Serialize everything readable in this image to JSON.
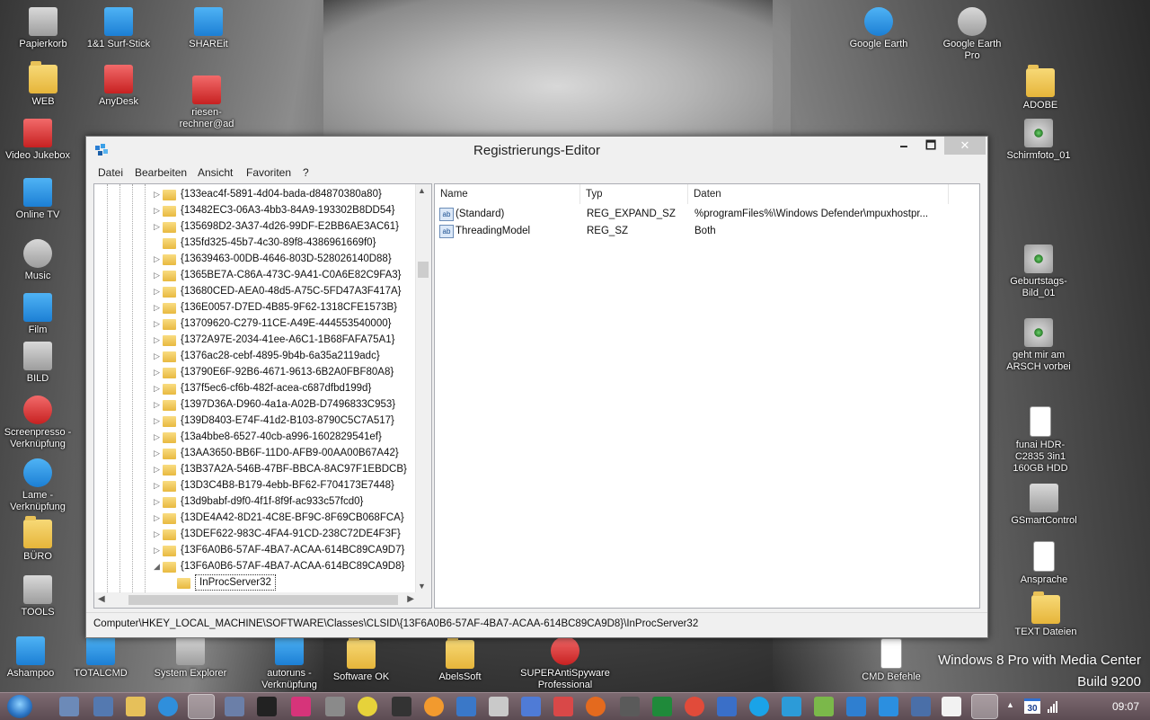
{
  "desktop": {
    "icons": [
      {
        "label": "Papierkorb",
        "icon": "recycle-bin"
      },
      {
        "label": "1&1 Surf-Stick",
        "icon": "surf-stick"
      },
      {
        "label": "SHAREit",
        "icon": "shareit"
      },
      {
        "label": "Google Earth",
        "icon": "google-earth"
      },
      {
        "label": "Google Earth Pro",
        "icon": "google-earth-pro"
      },
      {
        "label": "WEB",
        "icon": "folder"
      },
      {
        "label": "AnyDesk",
        "icon": "anydesk"
      },
      {
        "label": "riesen-rechner@ad",
        "icon": "shortcut"
      },
      {
        "label": "ADOBE",
        "icon": "folder"
      },
      {
        "label": "Video Jukebox",
        "icon": "jukebox"
      },
      {
        "label": "Schirmfoto_01",
        "icon": "eye-image"
      },
      {
        "label": "Online TV",
        "icon": "tv"
      },
      {
        "label": "Music",
        "icon": "music"
      },
      {
        "label": "Film",
        "icon": "film"
      },
      {
        "label": "Geburtstags-Bild_01",
        "icon": "eye-image"
      },
      {
        "label": "BILD",
        "icon": "camera"
      },
      {
        "label": "geht mir am ARSCH vorbei",
        "icon": "eye-image"
      },
      {
        "label": "Screenpresso - Verknüpfung",
        "icon": "screenpresso"
      },
      {
        "label": "funai HDR-C2835 3in1 160GB HDD",
        "icon": "document"
      },
      {
        "label": "Lame - Verknüpfung",
        "icon": "lame"
      },
      {
        "label": "BÜRO",
        "icon": "folder"
      },
      {
        "label": "GSmartControl",
        "icon": "gsmartcontrol"
      },
      {
        "label": "TOOLS",
        "icon": "tools"
      },
      {
        "label": "Ansprache",
        "icon": "document"
      },
      {
        "label": "TEXT Dateien",
        "icon": "folder"
      },
      {
        "label": "Ashampoo",
        "icon": "ashampoo"
      },
      {
        "label": "TOTALCMD",
        "icon": "totalcmd"
      },
      {
        "label": "System Explorer",
        "icon": "system-explorer"
      },
      {
        "label": "autoruns - Verknüpfung",
        "icon": "autoruns"
      },
      {
        "label": "Software OK",
        "icon": "folder"
      },
      {
        "label": "AbelsSoft",
        "icon": "folder"
      },
      {
        "label": "SUPERAntiSpyware Professional",
        "icon": "superantispyware"
      },
      {
        "label": "CMD Befehle",
        "icon": "pdf"
      }
    ],
    "watermark_line1": "Windows 8 Pro with Media Center",
    "watermark_line2": "Build 9200"
  },
  "window": {
    "title": "Registrierungs-Editor",
    "minimize": "🗕",
    "maximize": "🗖",
    "close": "✕",
    "menu": [
      "Datei",
      "Bearbeiten",
      "Ansicht",
      "Favoriten",
      "?"
    ],
    "tree": [
      {
        "label": "{133eac4f-5891-4d04-bada-d84870380a80}",
        "expander": "▷"
      },
      {
        "label": "{13482EC3-06A3-4bb3-84A9-193302B8DD54}",
        "expander": "▷"
      },
      {
        "label": "{135698D2-3A37-4d26-99DF-E2BB6AE3AC61}",
        "expander": "▷"
      },
      {
        "label": "{135fd325-45b7-4c30-89f8-4386961669f0}",
        "expander": ""
      },
      {
        "label": "{13639463-00DB-4646-803D-528026140D88}",
        "expander": "▷"
      },
      {
        "label": "{1365BE7A-C86A-473C-9A41-C0A6E82C9FA3}",
        "expander": "▷"
      },
      {
        "label": "{13680CED-AEA0-48d5-A75C-5FD47A3F417A}",
        "expander": "▷"
      },
      {
        "label": "{136E0057-D7ED-4B85-9F62-1318CFE1573B}",
        "expander": "▷"
      },
      {
        "label": "{13709620-C279-11CE-A49E-444553540000}",
        "expander": "▷"
      },
      {
        "label": "{1372A97E-2034-41ee-A6C1-1B68FAFA75A1}",
        "expander": "▷"
      },
      {
        "label": "{1376ac28-cebf-4895-9b4b-6a35a2119adc}",
        "expander": "▷"
      },
      {
        "label": "{13790E6F-92B6-4671-9613-6B2A0FBF80A8}",
        "expander": "▷"
      },
      {
        "label": "{137f5ec6-cf6b-482f-acea-c687dfbd199d}",
        "expander": "▷"
      },
      {
        "label": "{1397D36A-D960-4a1a-A02B-D7496833C953}",
        "expander": "▷"
      },
      {
        "label": "{139D8403-E74F-41d2-B103-8790C5C7A517}",
        "expander": "▷"
      },
      {
        "label": "{13a4bbe8-6527-40cb-a996-1602829541ef}",
        "expander": "▷"
      },
      {
        "label": "{13AA3650-BB6F-11D0-AFB9-00AA00B67A42}",
        "expander": "▷"
      },
      {
        "label": "{13B37A2A-546B-47BF-BBCA-8AC97F1EBDCB}",
        "expander": "▷"
      },
      {
        "label": "{13D3C4B8-B179-4ebb-BF62-F704173E7448}",
        "expander": "▷"
      },
      {
        "label": "{13d9babf-d9f0-4f1f-8f9f-ac933c57fcd0}",
        "expander": "▷"
      },
      {
        "label": "{13DE4A42-8D21-4C8E-BF9C-8F69CB068FCA}",
        "expander": "▷"
      },
      {
        "label": "{13DEF622-983C-4FA4-91CD-238C72DE4F3F}",
        "expander": "▷"
      },
      {
        "label": "{13F6A0B6-57AF-4BA7-ACAA-614BC89CA9D7}",
        "expander": "▷"
      },
      {
        "label": "{13F6A0B6-57AF-4BA7-ACAA-614BC89CA9D8}",
        "expander": "◢"
      },
      {
        "label": "InProcServer32",
        "expander": "",
        "child": true,
        "selected": true
      }
    ],
    "columns": [
      "Name",
      "Typ",
      "Daten"
    ],
    "values": [
      {
        "name": "(Standard)",
        "type": "REG_EXPAND_SZ",
        "data": "%programFiles%\\Windows Defender\\mpuxhostpr...",
        "icon": "ab"
      },
      {
        "name": "ThreadingModel",
        "type": "REG_SZ",
        "data": "Both",
        "icon": "ab"
      }
    ],
    "status": "Computer\\HKEY_LOCAL_MACHINE\\SOFTWARE\\Classes\\CLSID\\{13F6A0B6-57AF-4BA7-ACAA-614BC89CA9D8}\\InProcServer32"
  },
  "taskbar": {
    "clock": "09:07",
    "calendar_day": "30",
    "tray_arrow": "▲"
  }
}
